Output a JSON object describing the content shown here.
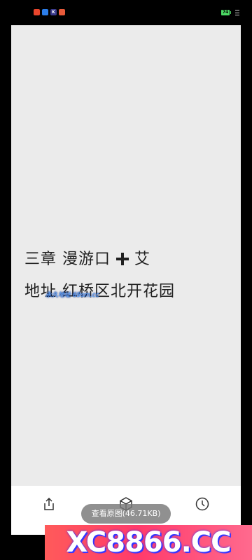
{
  "status_bar": {
    "notification_icons": [
      "app-icon-red",
      "app-icon-blue",
      "k-app-icon",
      "app-icon-orange"
    ],
    "k_icon_label": "K",
    "battery_level": "74"
  },
  "image": {
    "line1_part1": "三章 漫游口",
    "line1_part2": "艾",
    "line2": "地址 红桥区北开花园",
    "watermark": "永久地址 69sm.cc"
  },
  "toolbar": {
    "view_original_label": "查看原图(46.71KB)",
    "icons": [
      "share-icon",
      "cube-icon",
      "history-icon"
    ]
  },
  "banner": {
    "text": "XC8866.CC"
  },
  "colors": {
    "background": "#000000",
    "image_bg": "#ebebeb",
    "text": "#1f1f1f",
    "toolbar_bg": "#ffffff",
    "banner": "#ff3b6b",
    "watermark": "#5aa6ff"
  }
}
